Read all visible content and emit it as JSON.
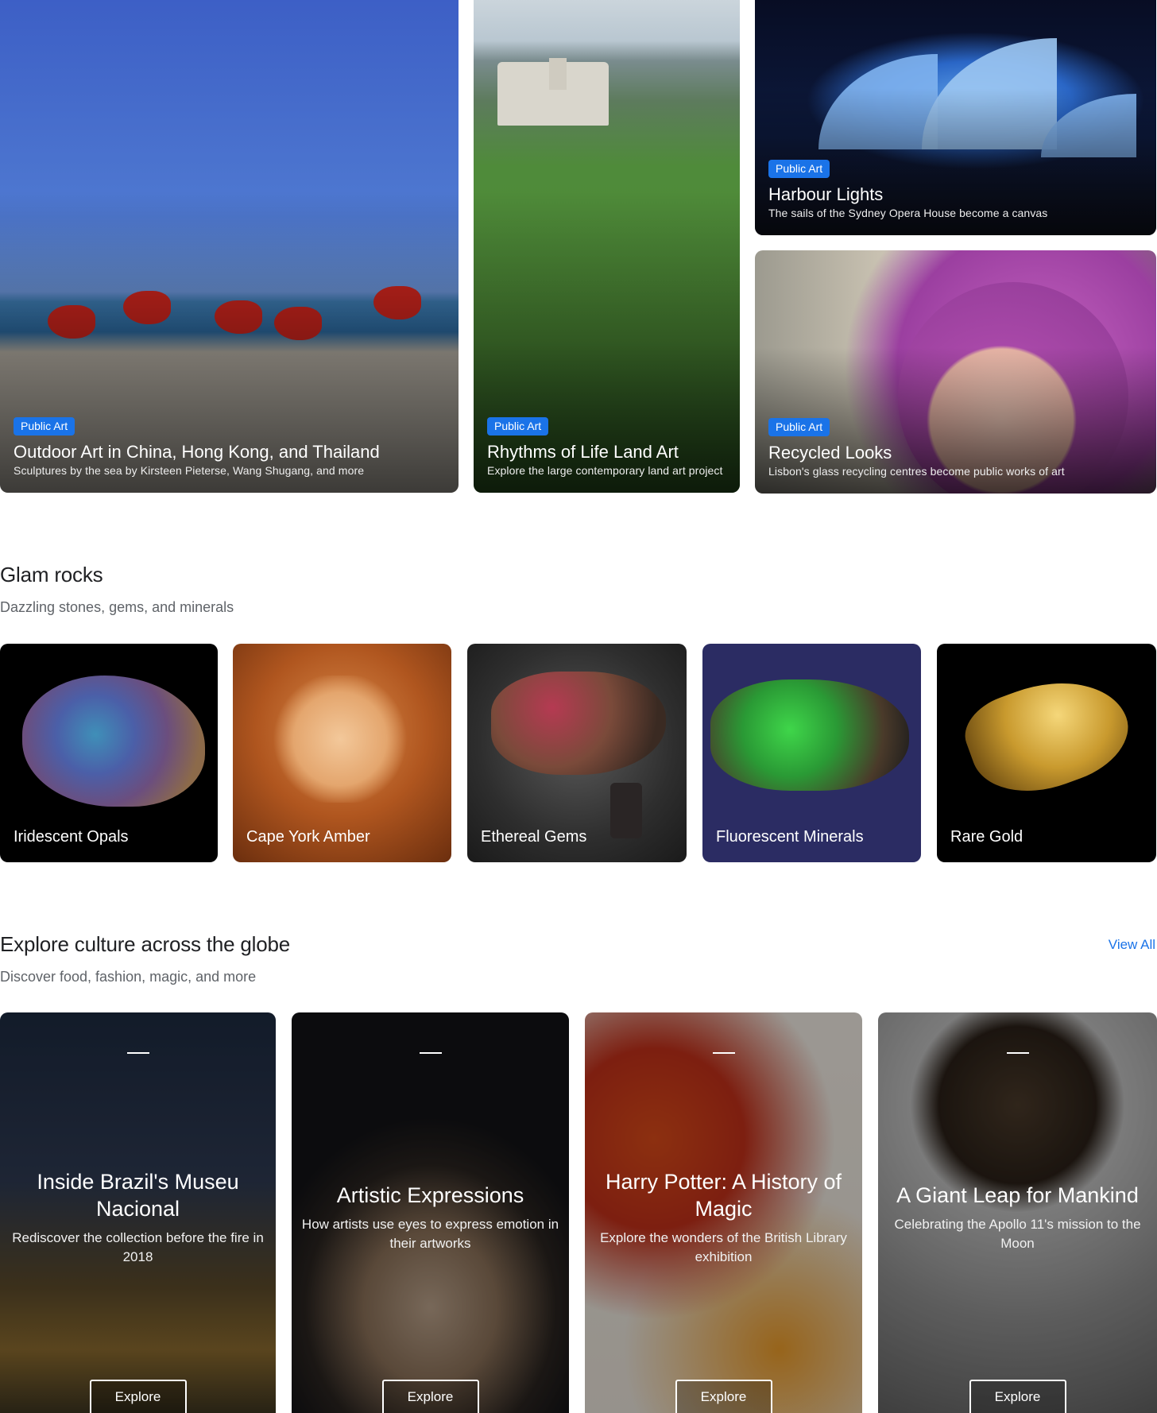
{
  "top_stories": [
    {
      "badge": "Public Art",
      "title": "Outdoor Art in China, Hong Kong, and Thailand",
      "subtitle": "Sculptures by the sea by Kirsteen Pieterse, Wang Shugang, and more"
    },
    {
      "badge": "Public Art",
      "title": "Rhythms of Life Land Art",
      "subtitle": "Explore the large contemporary land art project"
    },
    {
      "badge": "Public Art",
      "title": "Harbour Lights",
      "subtitle": "The sails of the Sydney Opera House become a canvas"
    },
    {
      "badge": "Public Art",
      "title": "Recycled Looks",
      "subtitle": "Lisbon's glass recycling centres become public works of art"
    }
  ],
  "glam": {
    "title": "Glam rocks",
    "subtitle": "Dazzling stones, gems, and minerals",
    "items": [
      {
        "label": "Iridescent Opals"
      },
      {
        "label": "Cape York Amber"
      },
      {
        "label": "Ethereal Gems"
      },
      {
        "label": "Fluorescent Minerals"
      },
      {
        "label": "Rare Gold"
      }
    ]
  },
  "explore": {
    "title": "Explore culture across the globe",
    "subtitle": "Discover food, fashion, magic, and more",
    "view_all": "View All",
    "cards": [
      {
        "title": "Inside Brazil's Museu Nacional",
        "subtitle": "Rediscover the collection before the fire in 2018",
        "button": "Explore"
      },
      {
        "title": "Artistic Expressions",
        "subtitle": "How artists use eyes to express emotion in their artworks",
        "button": "Explore"
      },
      {
        "title": "Harry Potter: A History of Magic",
        "subtitle": "Explore the wonders of the British Library exhibition",
        "button": "Explore"
      },
      {
        "title": "A Giant Leap for Mankind",
        "subtitle": "Celebrating the Apollo 11's mission to the Moon",
        "button": "Explore"
      }
    ]
  },
  "colors": {
    "accent": "#1a73e8",
    "badge_bg": "#1a73e8",
    "heading": "#202124",
    "subtext": "#5f6368"
  }
}
